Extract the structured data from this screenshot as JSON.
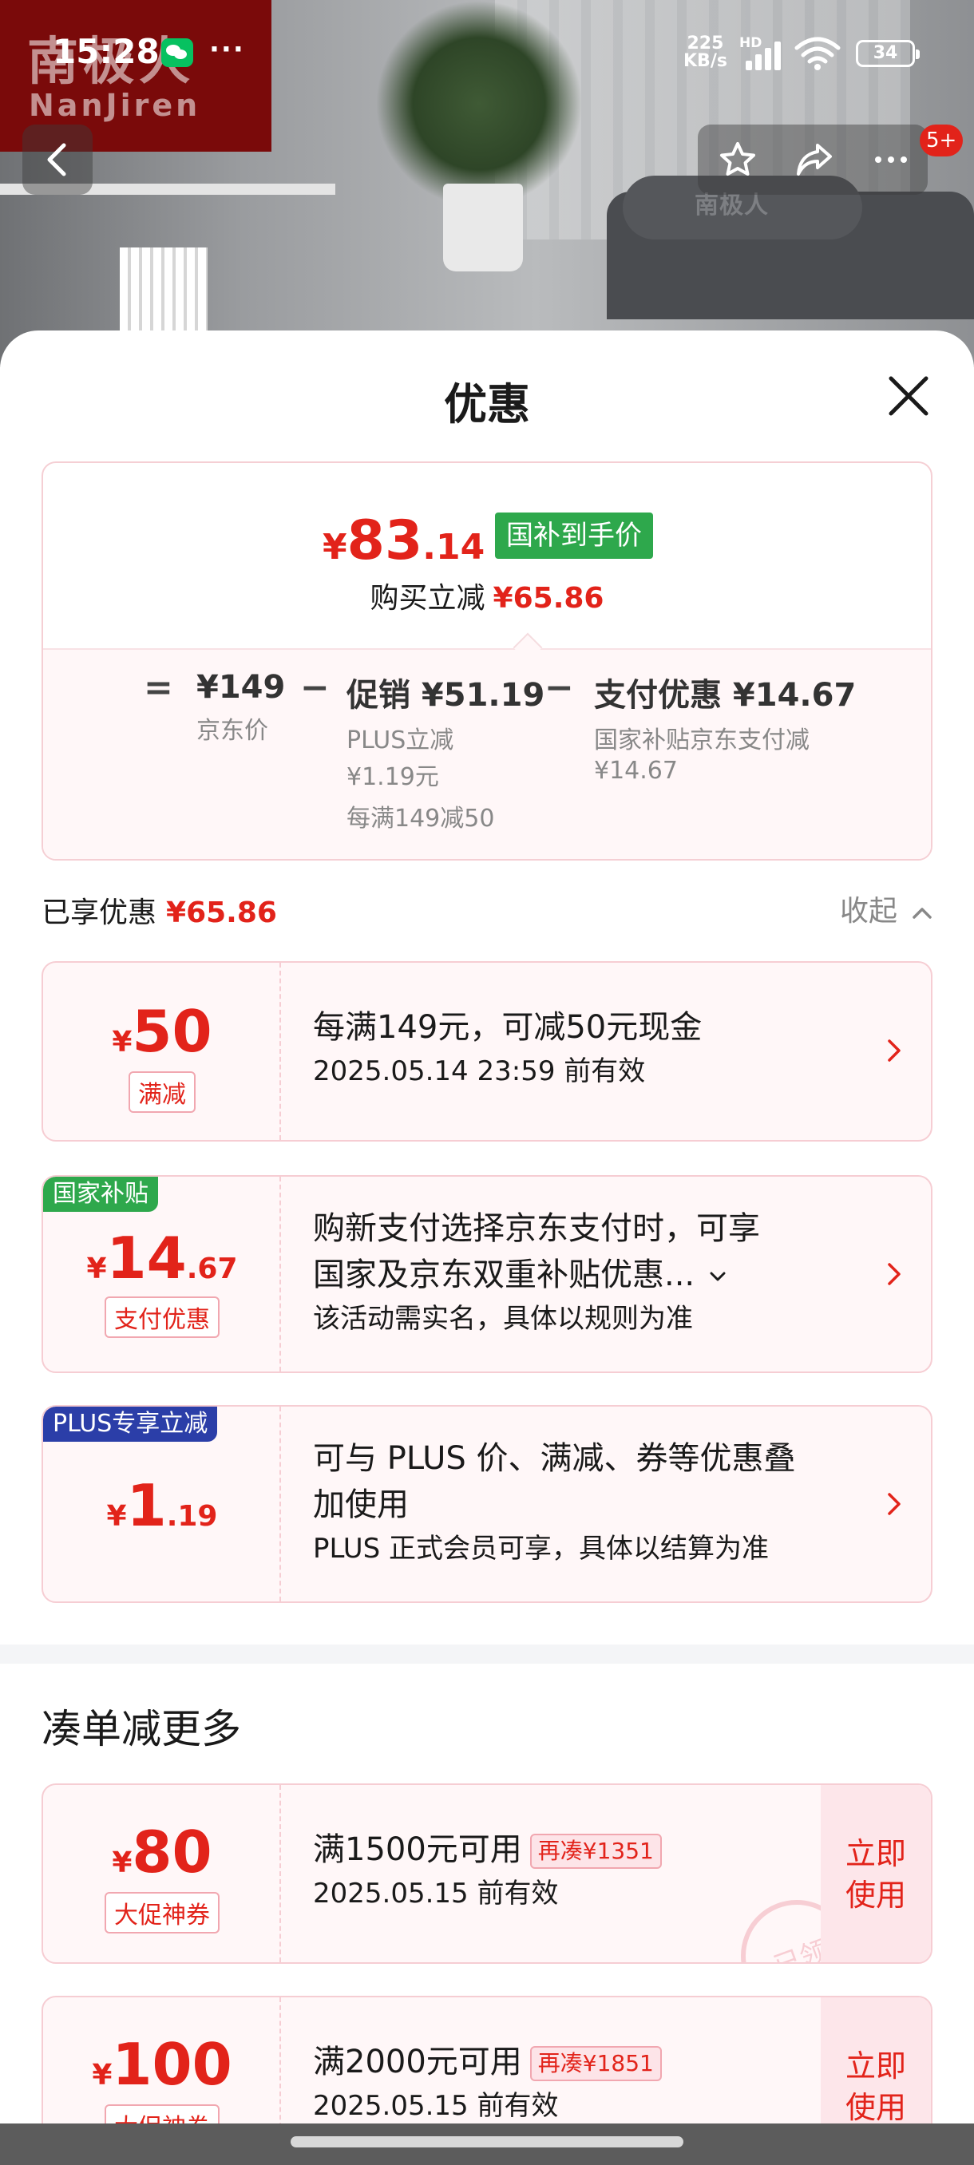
{
  "status_bar": {
    "time": "15:28",
    "net_speed_value": "225",
    "net_speed_unit": "KB/s",
    "hd": "HD",
    "battery": "34"
  },
  "brand": {
    "logo_cn": "南极人",
    "logo_en": "NanJiren",
    "pillow_logo": "南极人"
  },
  "nav": {
    "badge": "5+"
  },
  "sheet": {
    "title": "优惠"
  },
  "price_summary": {
    "currency": "¥",
    "price_int": "83",
    "price_dec": ".14",
    "tag": "国补到手价",
    "saving_label": "购买立减",
    "saving_value": "¥65.86",
    "breakdown": {
      "eq": "=",
      "jd_price": "¥149",
      "jd_price_label": "京东价",
      "minus1": "−",
      "promo": "促销 ¥51.19",
      "promo_plus": "PLUS立减",
      "promo_plus_value": "¥1.19元",
      "promo_rule": "每满149减50",
      "minus2": "−",
      "pay": "支付优惠 ¥14.67",
      "pay_label": "国家补贴京东支付减",
      "pay_value": "¥14.67"
    }
  },
  "enjoyed": {
    "label": "已享优惠",
    "value": "¥65.86",
    "collapse": "收起"
  },
  "coupons": [
    {
      "cur": "¥",
      "int": "50",
      "dec": "",
      "type": "满减",
      "title": "每满149元，可减50元现金",
      "desc": "2025.05.14 23:59 前有效"
    },
    {
      "corner": "国家补贴",
      "cur": "¥",
      "int": "14",
      "dec": ".67",
      "type": "支付优惠",
      "title1": "购新支付选择京东支付时，可享",
      "title2": "国家及京东双重补贴优惠...",
      "desc": "该活动需实名，具体以规则为准"
    },
    {
      "corner": "PLUS专享立减",
      "cur": "¥",
      "int": "1",
      "dec": ".19",
      "title1": "可与 PLUS 价、满减、券等优惠叠",
      "title2": "加使用",
      "desc": "PLUS 正式会员可享，具体以结算为准"
    }
  ],
  "more_section": {
    "title": "凑单减更多"
  },
  "more_coupons": [
    {
      "cur": "¥",
      "int": "80",
      "type": "大促神券",
      "title": "满1500元可用",
      "pill": "再凑¥1351",
      "valid": "2025.05.15 前有效",
      "use1": "立即",
      "use2": "使用",
      "stamp": "已领"
    },
    {
      "cur": "¥",
      "int": "100",
      "type": "大促神券",
      "title": "满2000元可用",
      "pill": "再凑¥1851",
      "valid": "2025.05.15 前有效",
      "use1": "立即",
      "use2": "使用"
    }
  ],
  "colors": {
    "accent": "#e2231a",
    "green_tag": "#2ea84c",
    "plus_blue": "#2b3ea8"
  }
}
